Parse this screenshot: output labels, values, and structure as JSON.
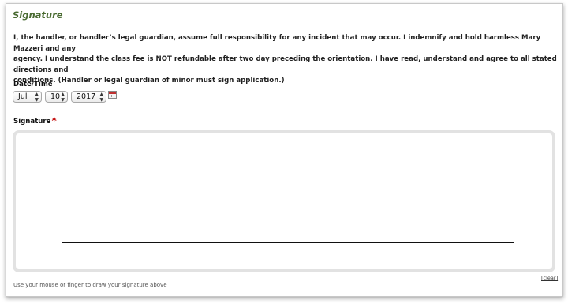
{
  "section": {
    "title": "Signature"
  },
  "disclaimer": {
    "line1": "I, the handler, or handler’s legal guardian, assume full responsibility for any incident that may occur. I indemnify and hold harmless Mary Mazzeri and any",
    "line2": "agency. I understand the class fee is NOT refundable after two day preceding the orientation. I have read, understand and agree to all stated directions and",
    "line3": "conditions. (Handler or legal guardian of minor must sign application.)"
  },
  "date_field": {
    "label": "Date/Time",
    "month": "Jul",
    "day": "10",
    "year": "2017",
    "calendar_icon": "calendar-icon"
  },
  "signature_field": {
    "label": "Signature",
    "required_marker": "*",
    "clear_label": "[clear]",
    "help_text": "Use your mouse or finger to draw your signature above"
  },
  "colors": {
    "title": "#4a6b32",
    "required": "#c00000",
    "pad_border": "#e2e2e2"
  }
}
